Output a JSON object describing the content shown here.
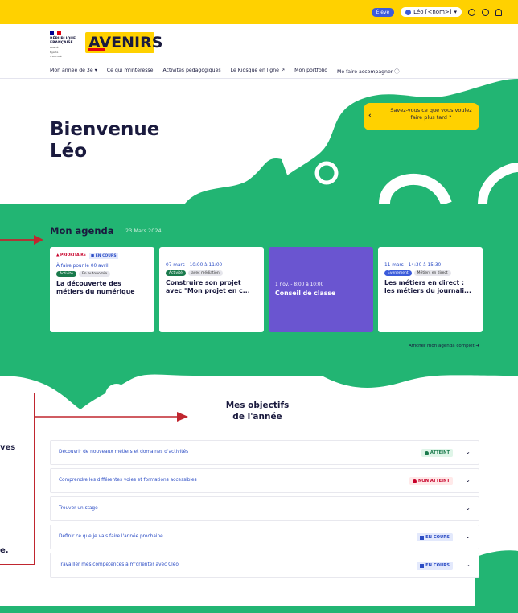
{
  "topbar": {
    "role": "Élève",
    "user": "Léo [<nom>]",
    "colors": {
      "bar": "#ffd100",
      "role_pill": "#3b5bdb"
    }
  },
  "header": {
    "republique_lines": [
      "RÉPUBLIQUE",
      "FRANÇAISE"
    ],
    "motto": [
      "Liberté",
      "Égalité",
      "Fraternité"
    ],
    "logo_text": "AVENIRS"
  },
  "nav": {
    "items": [
      "Mon année de 3e",
      "Ce qui m'intéresse",
      "Activités pédagogiques",
      "Le Kiosque en ligne",
      "Mon portfolio",
      "Me faire accompagner"
    ]
  },
  "hero": {
    "greeting": "Bienvenue",
    "name": "Léo",
    "bubble": "Savez-vous ce que vous voulez faire plus tard ?",
    "colors": {
      "shape": "#22b573",
      "bubble": "#ffd100"
    }
  },
  "agenda": {
    "title": "Mon agenda",
    "date": "23 Mars 2024",
    "link": "Afficher mon agenda complet",
    "cards": [
      {
        "tags": [
          "PRIORITAIRE",
          "EN COURS"
        ],
        "date": "À faire pour le 00 avril",
        "pills": [
          "Activité",
          "En autonomie"
        ],
        "title": "La découverte des métiers du numérique"
      },
      {
        "date": "07 mars - 10:00 à 11:00",
        "pills": [
          "Activité",
          "avec médiation"
        ],
        "title": "Construire son projet avec \"Mon projet en c..."
      },
      {
        "date": "1 nov. - 8:00 à 10:00",
        "title": "Conseil de classe"
      },
      {
        "date": "11 mars - 14:30 à 15:30",
        "pills": [
          "Evènement",
          "Métiers en direct"
        ],
        "title": "Les métiers en direct : les métiers du journali..."
      }
    ],
    "colors": {
      "band": "#22b573",
      "purple_card": "#6a55d0"
    }
  },
  "objectives": {
    "title_lines": [
      "Mes objectifs",
      "de l'année"
    ],
    "rows": [
      {
        "label": "Découvrir de nouveaux métiers et domaines d'activités",
        "status": "ATTEINT",
        "kind": "green"
      },
      {
        "label": "Comprendre les différentes voies et formations accessibles",
        "status": "NON ATTEINT",
        "kind": "red"
      },
      {
        "label": "Trouver un stage",
        "status": "",
        "kind": ""
      },
      {
        "label": "Définir ce que je vais faire l'année prochaine",
        "status": "EN COURS",
        "kind": "blue"
      },
      {
        "label": "Travailler mes compétences à m'orienter avec Cleo",
        "status": "EN COURS",
        "kind": "blue"
      }
    ]
  },
  "annotation": {
    "fragments": [
      "ves",
      "e."
    ],
    "color": "#c0262f"
  }
}
